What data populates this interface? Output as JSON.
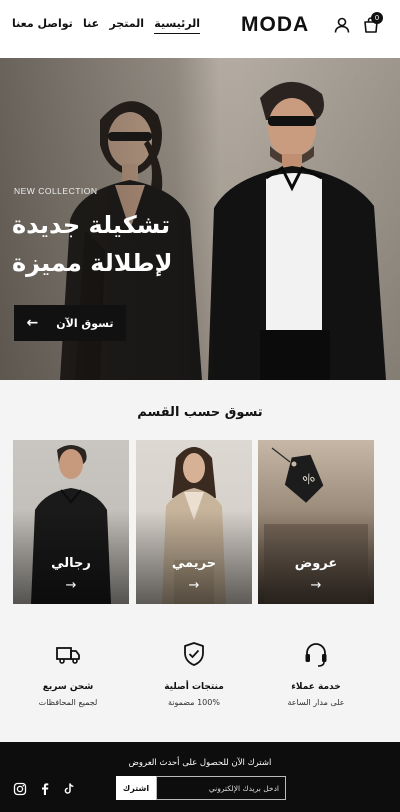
{
  "header": {
    "logo": "MODA",
    "cart_count": "0",
    "nav": [
      "الرئيسية",
      "المتجر",
      "عنا",
      "تواصل معنا"
    ]
  },
  "hero": {
    "eyebrow": "NEW COLLECTION",
    "title": "تشكيلة جديدة لإطلالة مميزة",
    "button": "تسوق الآن"
  },
  "categories": {
    "title": "تسوق حسب القسم",
    "items": [
      {
        "label": "عروض",
        "arrow": "→"
      },
      {
        "label": "حريمي",
        "arrow": "→"
      },
      {
        "label": "رجالي",
        "arrow": "→"
      }
    ]
  },
  "features": [
    {
      "icon": "headset-icon",
      "title": "خدمة عملاء",
      "subtitle": "على مدار الساعة"
    },
    {
      "icon": "shield-check-icon",
      "title": "منتجات أصلية",
      "subtitle": "100% مضمونة"
    },
    {
      "icon": "truck-icon",
      "title": "شحن سريع",
      "subtitle": "لجميع المحافظات"
    }
  ],
  "footer": {
    "cta": "اشترك الآن للحصول على أحدث العروض",
    "email_placeholder": "ادخل بريدك الإلكتروني",
    "submit": "اشترك",
    "social": [
      "tiktok-icon",
      "facebook-icon",
      "instagram-icon"
    ]
  },
  "colors": {
    "primary": "#111111",
    "background": "#f4f4f4",
    "footer": "#0d0d0d"
  }
}
